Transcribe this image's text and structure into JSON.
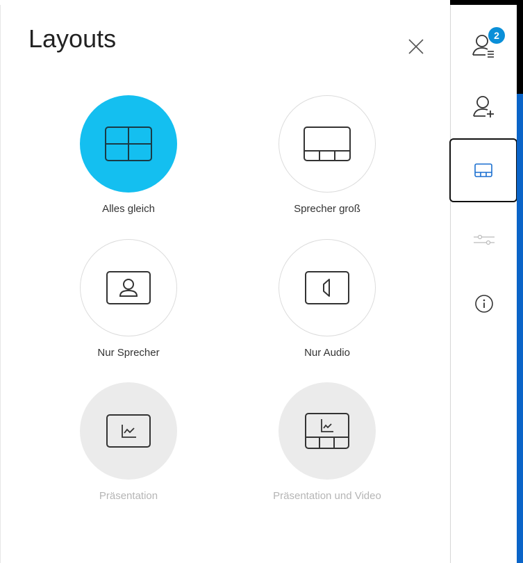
{
  "panel": {
    "title": "Layouts",
    "options": [
      {
        "label": "Alles gleich",
        "icon": "grid-layout-icon",
        "state": "active"
      },
      {
        "label": "Sprecher groß",
        "icon": "speaker-large-layout-icon",
        "state": "default"
      },
      {
        "label": "Nur Sprecher",
        "icon": "speaker-only-layout-icon",
        "state": "default"
      },
      {
        "label": "Nur Audio",
        "icon": "audio-only-layout-icon",
        "state": "default"
      },
      {
        "label": "Präsentation",
        "icon": "presentation-layout-icon",
        "state": "disabled"
      },
      {
        "label": "Präsentation und Video",
        "icon": "presentation-video-layout-icon",
        "state": "disabled"
      }
    ]
  },
  "rail": {
    "participants_badge": "2",
    "items": [
      {
        "icon": "participants-list-icon"
      },
      {
        "icon": "add-participant-icon"
      },
      {
        "icon": "layout-icon",
        "selected": true
      },
      {
        "icon": "settings-sliders-icon",
        "disabled": true
      },
      {
        "icon": "info-icon"
      }
    ]
  },
  "colors": {
    "accent": "#14bff0",
    "disabled_bg": "#ebebeb",
    "badge": "#0a8fd8",
    "edge_blue": "#0a64c8"
  }
}
